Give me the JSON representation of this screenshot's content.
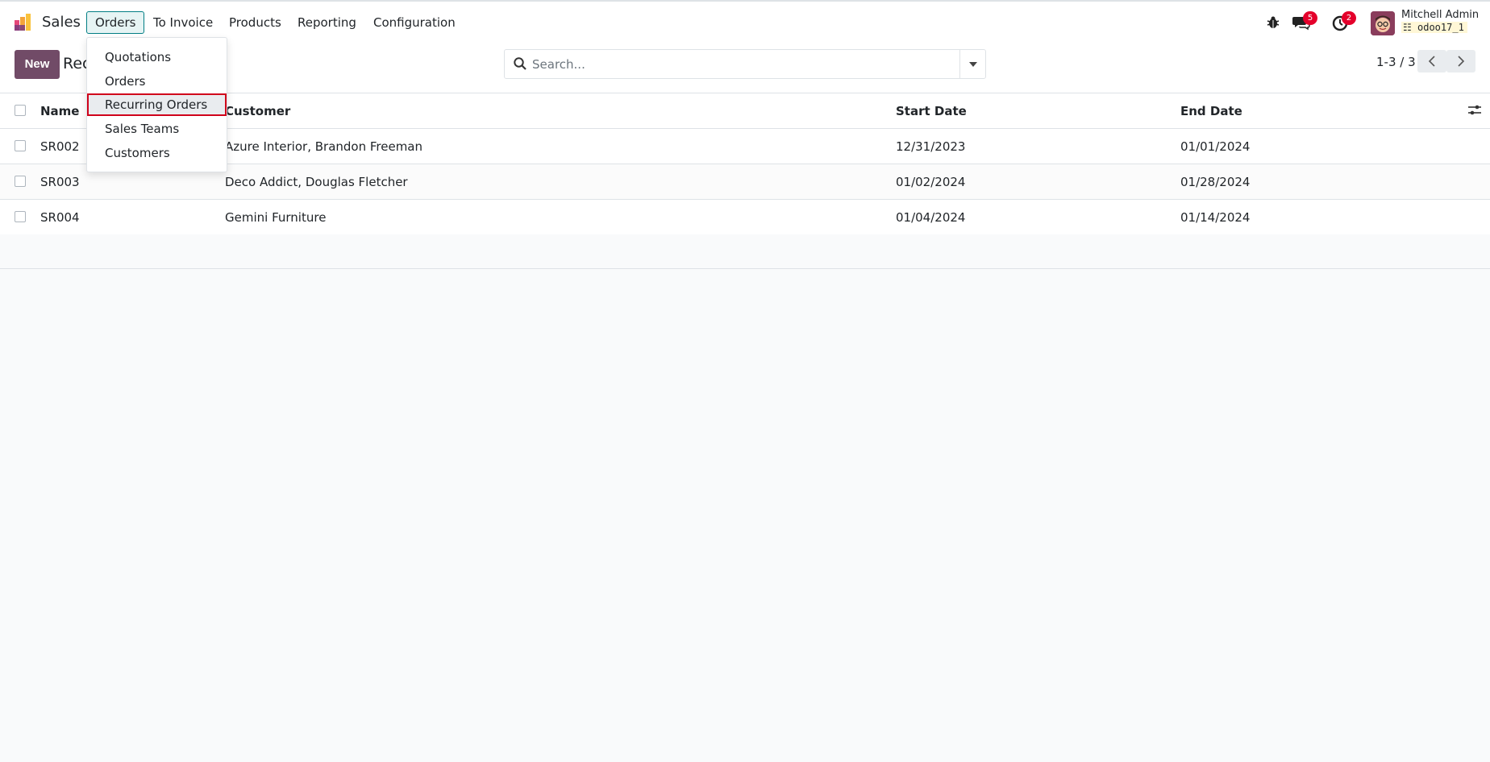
{
  "navbar": {
    "app_name": "Sales",
    "menu": {
      "orders": "Orders",
      "to_invoice": "To Invoice",
      "products": "Products",
      "reporting": "Reporting",
      "configuration": "Configuration"
    },
    "messages_badge": "5",
    "activities_badge": "2",
    "user_name": "Mitchell Admin",
    "database": "odoo17_1"
  },
  "orders_dropdown": {
    "items": [
      "Quotations",
      "Orders",
      "Recurring Orders",
      "Sales Teams",
      "Customers"
    ],
    "highlighted": "Recurring Orders"
  },
  "control_panel": {
    "new_label": "New",
    "title": "Recurring Orders",
    "search_placeholder": "Search...",
    "pager": "1-3 / 3"
  },
  "table": {
    "columns": [
      "Name",
      "Customer",
      "Start Date",
      "End Date"
    ],
    "rows": [
      {
        "name": "SR002",
        "customer": "Azure Interior, Brandon Freeman",
        "start_date": "12/31/2023",
        "end_date": "01/01/2024"
      },
      {
        "name": "SR003",
        "customer": "Deco Addict, Douglas Fletcher",
        "start_date": "01/02/2024",
        "end_date": "01/28/2024"
      },
      {
        "name": "SR004",
        "customer": "Gemini Furniture",
        "start_date": "01/04/2024",
        "end_date": "01/14/2024"
      }
    ]
  },
  "colors": {
    "brand": "#714b67",
    "active_menu": "#017e84",
    "badge": "#e4002b",
    "highlight_border": "#d0021b"
  }
}
